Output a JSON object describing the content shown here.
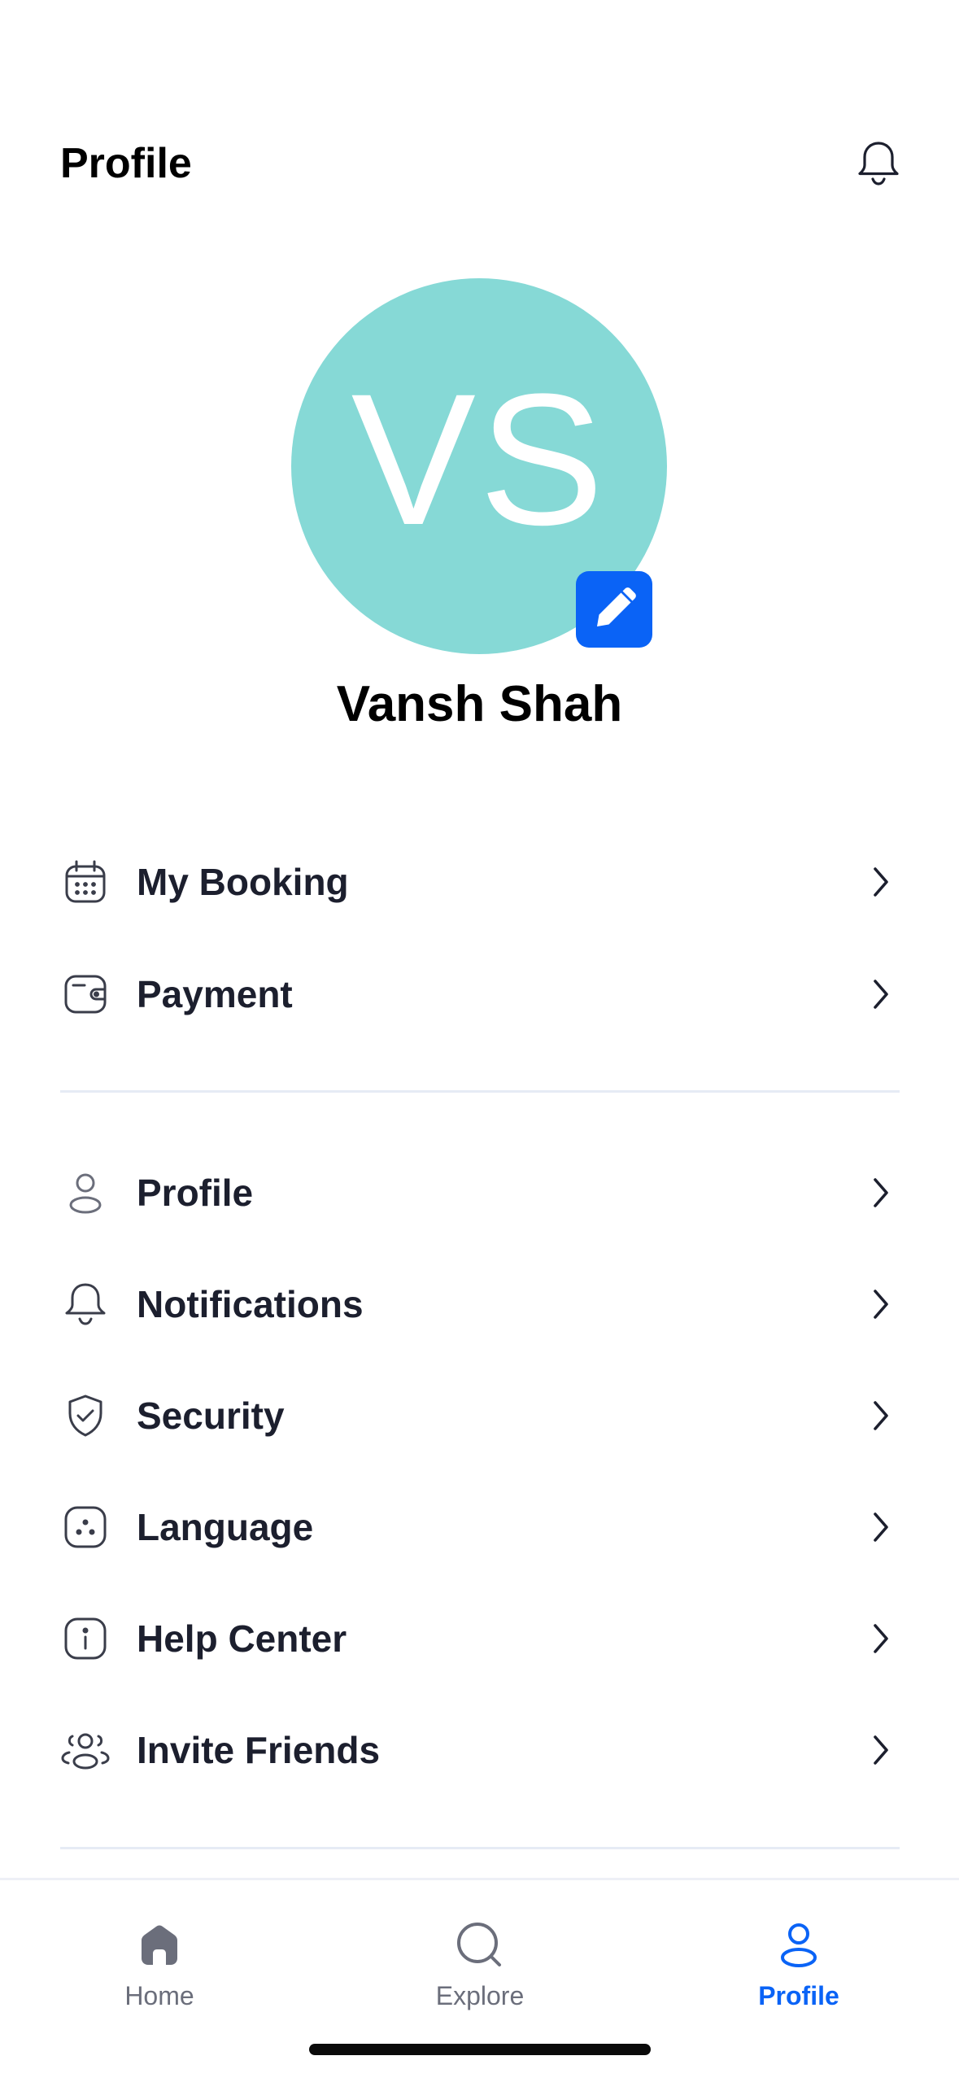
{
  "header": {
    "title": "Profile",
    "notification_icon": "bell-icon"
  },
  "user": {
    "initials": "VS",
    "name": "Vansh Shah",
    "avatar_color": "#86d9d6",
    "edit_icon": "pencil-icon"
  },
  "menu_group_1": [
    {
      "label": "My Booking",
      "icon": "calendar-icon"
    },
    {
      "label": "Payment",
      "icon": "wallet-icon"
    }
  ],
  "menu_group_2": [
    {
      "label": "Profile",
      "icon": "user-icon"
    },
    {
      "label": "Notifications",
      "icon": "bell-icon"
    },
    {
      "label": "Security",
      "icon": "shield-check-icon"
    },
    {
      "label": "Language",
      "icon": "language-icon"
    },
    {
      "label": "Help Center",
      "icon": "info-icon"
    },
    {
      "label": "Invite Friends",
      "icon": "users-icon"
    }
  ],
  "bottom_nav": {
    "items": [
      {
        "label": "Home",
        "icon": "home-icon",
        "active": false
      },
      {
        "label": "Explore",
        "icon": "search-icon",
        "active": false
      },
      {
        "label": "Profile",
        "icon": "user-icon",
        "active": true
      }
    ]
  },
  "colors": {
    "accent": "#0a63f6",
    "text": "#1c1f2e",
    "inactive_nav": "#6b6e7b",
    "divider": "#e6ebf5"
  }
}
